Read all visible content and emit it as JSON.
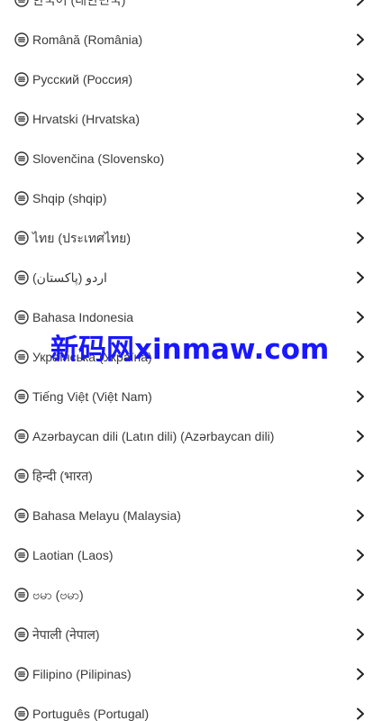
{
  "languages": [
    {
      "label": "한국어 (대한민국)"
    },
    {
      "label": "Română (România)"
    },
    {
      "label": "Русский (Россия)"
    },
    {
      "label": "Hrvatski (Hrvatska)"
    },
    {
      "label": "Slovenčina (Slovensko)"
    },
    {
      "label": "Shqip (shqip)"
    },
    {
      "label": "ไทย (ประเทศไทย)"
    },
    {
      "label": "اردو (پاکستان)"
    },
    {
      "label": "Bahasa Indonesia"
    },
    {
      "label": "Українська (Україна)"
    },
    {
      "label": "Tiếng Việt (Việt Nam)"
    },
    {
      "label": "Azərbaycan dili (Latın dili) (Azərbaycan dili)"
    },
    {
      "label": "हिन्दी (भारत)"
    },
    {
      "label": "Bahasa Melayu (Malaysia)"
    },
    {
      "label": "Laotian (Laos)"
    },
    {
      "label": "ဗမာ (ဗမာ)"
    },
    {
      "label": "नेपाली (नेपाल)"
    },
    {
      "label": "Filipino (Pilipinas)"
    },
    {
      "label": "Português (Portugal)"
    }
  ],
  "icons": {
    "row_icon": "language-icon",
    "row_arrow": "chevron-right-icon"
  },
  "watermark": {
    "text": "新码网xinmaw.com",
    "color": "#1a17ff"
  }
}
